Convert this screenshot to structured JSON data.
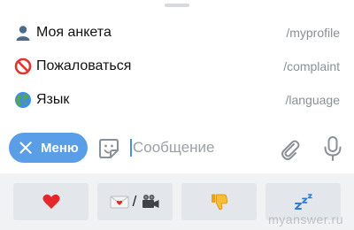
{
  "commands": [
    {
      "icon": "bust-in-silhouette-icon",
      "description": "Моя анкета",
      "command": "/myprofile"
    },
    {
      "icon": "no-entry-icon",
      "description": "Пожаловаться",
      "command": "/complaint"
    },
    {
      "icon": "globe-icon",
      "description": "Язык",
      "command": "/language"
    }
  ],
  "input_bar": {
    "menu_label": "Меню",
    "placeholder": "Сообщение",
    "accent_color": "#5a9ee8"
  },
  "keyboard": {
    "buttons": [
      {
        "icon": "red-heart-icon"
      },
      {
        "icon": "love-letter-icon",
        "separator": "/",
        "icon2": "video-camera-icon"
      },
      {
        "icon": "thumbs-down-icon"
      },
      {
        "icon": "zzz-icon"
      }
    ]
  },
  "watermark": "myanswer.ru"
}
